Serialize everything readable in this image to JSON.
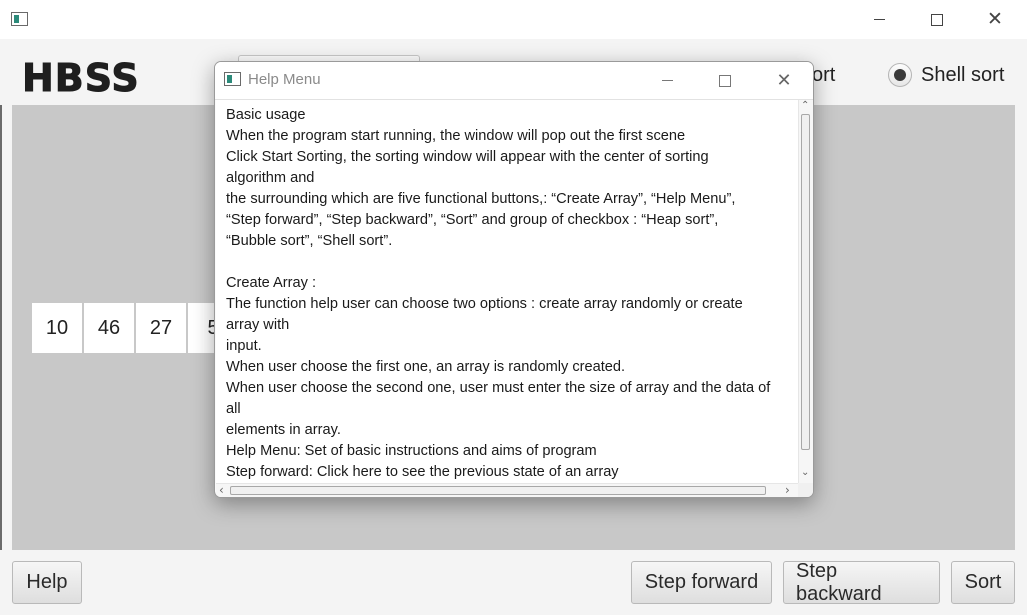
{
  "main_window": {
    "title": "",
    "logo": "HBSS",
    "radio_partial_label": "ort",
    "radio_shell_label": "Shell sort",
    "window_controls": {
      "minimize": "minimize-icon",
      "maximize": "maximize-icon",
      "close": "close-icon"
    }
  },
  "array": {
    "cells": [
      "10",
      "46",
      "27",
      "5"
    ]
  },
  "buttons": {
    "help": "Help",
    "step_forward": "Step forward",
    "step_backward": "Step backward",
    "sort": "Sort"
  },
  "dialog": {
    "title": "Help Menu",
    "close_glyph": "✕",
    "lines": [
      "Basic usage",
      "When the program start running, the window will pop out the first scene",
      "Click Start Sorting, the sorting window will appear with the center of sorting",
      "algorithm and",
      "the surrounding which are five functional buttons,: “Create Array”, “Help Menu”,",
      "“Step forward”,  “Step backward”, “Sort” and group of checkbox : “Heap sort”,",
      "“Bubble sort”, “Shell sort”.",
      "",
      "Create Array :",
      "The function help user can choose two options : create array randomly or create",
      "array with",
      "input.",
      "When user choose the first one, an array is randomly created.",
      "When user choose the second one, user must enter the size of array and the data of",
      "all",
      "elements in array.",
      "Help Menu: Set of basic instructions and aims of program",
      "Step forward: Click here to see the previous state of an array"
    ]
  },
  "colors": {
    "canvas_bg": "#c8c8c8",
    "window_bg": "#f4f4f4",
    "icon_accent": "#2c8a7a"
  }
}
